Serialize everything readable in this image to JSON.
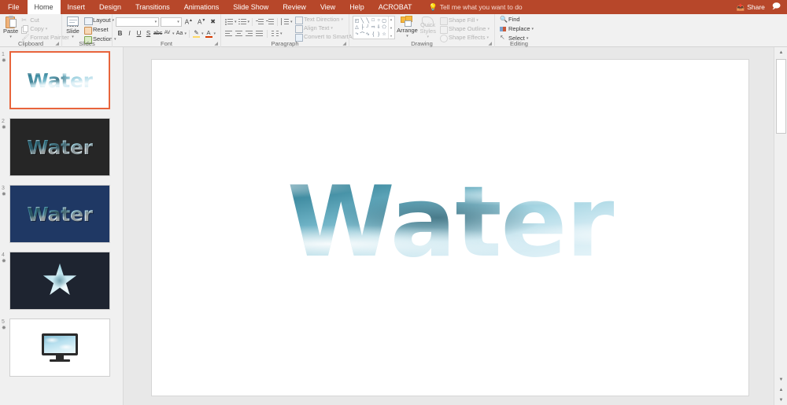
{
  "window": {
    "tabs": [
      {
        "id": "file",
        "label": "File",
        "active": false
      },
      {
        "id": "home",
        "label": "Home",
        "active": true
      },
      {
        "id": "insert",
        "label": "Insert",
        "active": false
      },
      {
        "id": "design",
        "label": "Design",
        "active": false
      },
      {
        "id": "transitions",
        "label": "Transitions",
        "active": false
      },
      {
        "id": "animations",
        "label": "Animations",
        "active": false
      },
      {
        "id": "slideshow",
        "label": "Slide Show",
        "active": false
      },
      {
        "id": "review",
        "label": "Review",
        "active": false
      },
      {
        "id": "view",
        "label": "View",
        "active": false
      },
      {
        "id": "help",
        "label": "Help",
        "active": false
      },
      {
        "id": "acrobat",
        "label": "ACROBAT",
        "active": false
      }
    ],
    "tellme": "Tell me what you want to do",
    "tellme_icon": "lightbulb-icon",
    "share_label": "Share",
    "share_icon": "share-icon",
    "comments_icon": "comment-icon",
    "ribbon_color": "#b7472a",
    "accent_selection": "#e8643c"
  },
  "ribbon": {
    "clipboard": {
      "title": "Clipboard",
      "paste": "Paste",
      "cut": "Cut",
      "copy": "Copy",
      "format_painter": "Format Painter"
    },
    "slides": {
      "title": "Slides",
      "new_slide": "New Slide",
      "layout": "Layout",
      "reset": "Reset",
      "section": "Section"
    },
    "font": {
      "title": "Font",
      "font_name": "",
      "font_name_placeholder": "",
      "font_size": "",
      "grow_font": "A",
      "shrink_font": "A",
      "clear_formatting": "Clear All Formatting",
      "bold": "B",
      "italic": "I",
      "underline": "U",
      "shadow": "S",
      "strikethrough": "abc",
      "char_spacing": "AV",
      "change_case": "Aa",
      "text_highlight": "✎",
      "font_color": "A"
    },
    "paragraph": {
      "title": "Paragraph",
      "bullets": "Bullets",
      "numbering": "Numbering",
      "decrease_indent": "Decrease List Level",
      "increase_indent": "Increase List Level",
      "line_spacing": "Line Spacing",
      "align_left": "Align Left",
      "align_center": "Center",
      "align_right": "Align Right",
      "justify": "Justify",
      "columns": "Columns",
      "text_direction": "Text Direction",
      "align_text": "Align Text",
      "convert_smartart": "Convert to SmartArt"
    },
    "drawing": {
      "title": "Drawing",
      "shapes_gallery": "Shapes",
      "arrange": "Arrange",
      "quick_styles": "Quick Styles",
      "shape_fill": "Shape Fill",
      "shape_outline": "Shape Outline",
      "shape_effects": "Shape Effects",
      "shape_glyphs": [
        "◰",
        "╲",
        "╲",
        "□",
        "○",
        "▢",
        "△",
        "├",
        "┘",
        "⇨",
        "⇩",
        "⬠",
        "⤷",
        "⌒",
        "∿",
        "{",
        "}",
        "☆"
      ]
    },
    "editing": {
      "title": "Editing",
      "find": "Find",
      "replace": "Replace",
      "select": "Select"
    }
  },
  "thumbnails": [
    {
      "number": "1",
      "star": "✸",
      "selected": true,
      "kind": "text",
      "text": "Water",
      "bg": "#ffffff",
      "fill": "water",
      "shadow": false
    },
    {
      "number": "2",
      "star": "✸",
      "selected": false,
      "kind": "text",
      "text": "Water",
      "bg": "#262626",
      "fill": "water",
      "shadow": true
    },
    {
      "number": "3",
      "star": "✸",
      "selected": false,
      "kind": "text",
      "text": "Water",
      "bg": "#1f3864",
      "fill": "water",
      "shadow": true
    },
    {
      "number": "4",
      "star": "✸",
      "selected": false,
      "kind": "star",
      "text": "",
      "bg": "#1e2430",
      "fill": "water",
      "shadow": false
    },
    {
      "number": "5",
      "star": "✸",
      "selected": false,
      "kind": "monitor",
      "text": "",
      "bg": "#ffffff",
      "fill": "water",
      "shadow": false
    }
  ],
  "slide": {
    "title_text": "Water",
    "background": "#ffffff",
    "text_fill": "water-picture-fill"
  },
  "scrollbar": {
    "up_arrow": "▲",
    "down_arrow": "▼",
    "prev_slide": "▲",
    "next_slide": "▼",
    "slide_sorter": "▤"
  }
}
